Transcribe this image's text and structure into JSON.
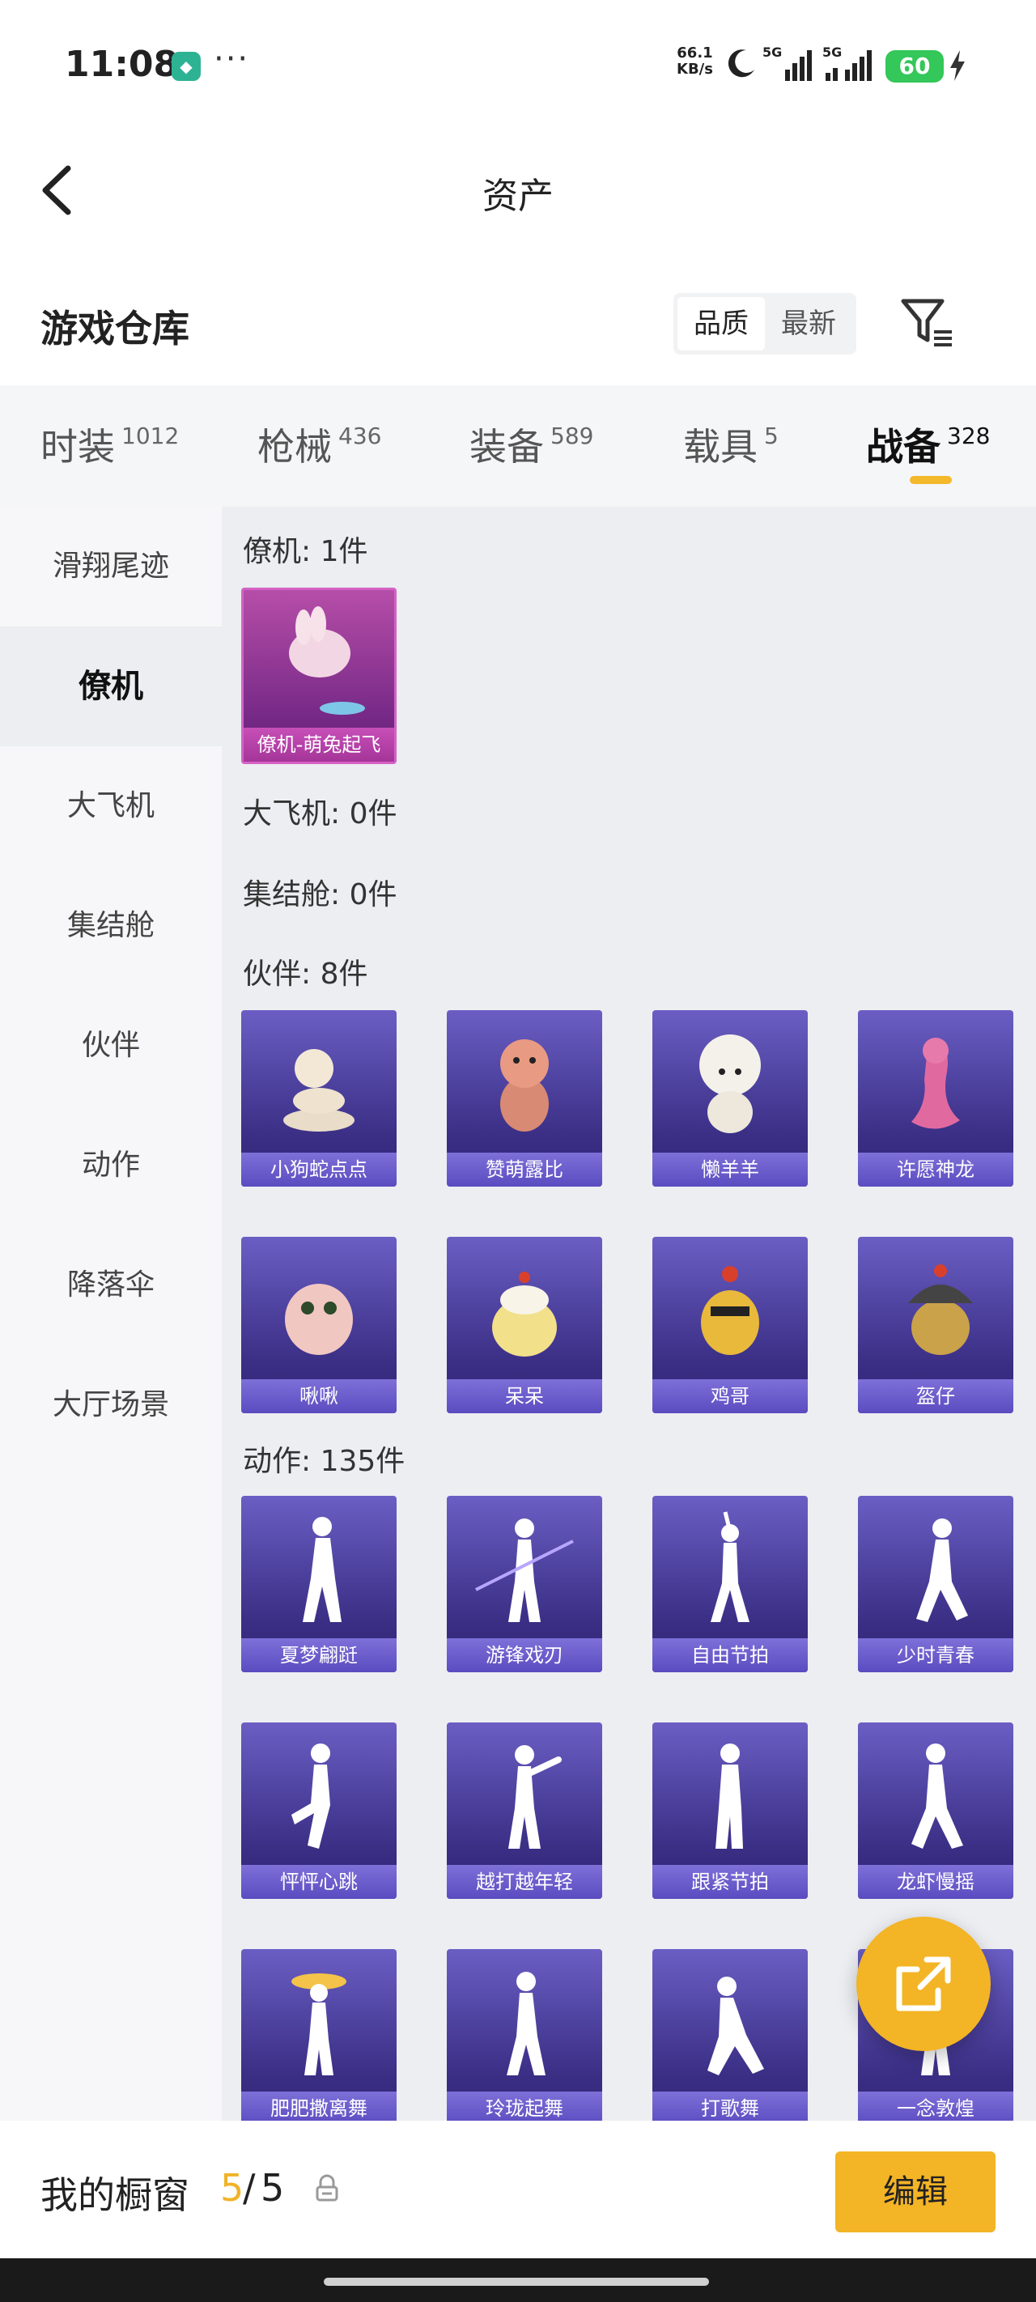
{
  "status_bar": {
    "time": "11:08",
    "chat_icon": "wechat-icon",
    "more": "···",
    "speed_value": "66.1",
    "speed_unit": "KB/s",
    "network_1": "5G",
    "network_2": "5G",
    "battery": "60"
  },
  "header": {
    "title": "资产",
    "back_icon": "back-arrow-icon"
  },
  "warehouse": {
    "title": "游戏仓库",
    "sort_options": [
      "品质",
      "最新"
    ],
    "active_sort": "品质",
    "filter_icon": "filter-icon"
  },
  "category_tabs": [
    {
      "label": "时装",
      "count": "1012"
    },
    {
      "label": "枪械",
      "count": "436"
    },
    {
      "label": "装备",
      "count": "589"
    },
    {
      "label": "载具",
      "count": "5"
    },
    {
      "label": "战备",
      "count": "328"
    }
  ],
  "active_tab": "战备",
  "sidebar": [
    {
      "label": "滑翔尾迹"
    },
    {
      "label": "僚机"
    },
    {
      "label": "大飞机"
    },
    {
      "label": "集结舱"
    },
    {
      "label": "伙伴"
    },
    {
      "label": "动作"
    },
    {
      "label": "降落伞"
    },
    {
      "label": "大厅场景"
    }
  ],
  "active_sidebar": "僚机",
  "groups": {
    "wingman": {
      "heading": "僚机: 1件",
      "items": [
        "僚机-萌兔起飞"
      ]
    },
    "big_plane": {
      "heading": "大飞机: 0件"
    },
    "assembly_pod": {
      "heading": "集结舱: 0件"
    },
    "partner": {
      "heading": "伙伴: 8件",
      "items": [
        "小狗蛇点点",
        "赞萌露比",
        "懒羊羊",
        "许愿神龙",
        "啾啾",
        "呆呆",
        "鸡哥",
        "盔仔"
      ]
    },
    "action": {
      "heading": "动作: 135件",
      "items": [
        "夏梦翩跹",
        "游锋戏刃",
        "自由节拍",
        "少时青春",
        "怦怦心跳",
        "越打越年轻",
        "跟紧节拍",
        "龙虾慢摇",
        "肥肥撒离舞",
        "玲珑起舞",
        "打歌舞",
        "一念敦煌"
      ]
    }
  },
  "fab_icon": "share-external-icon",
  "bottom_bar": {
    "label": "我的橱窗",
    "current": "5",
    "slash": "/",
    "max": "5",
    "lock_icon": "lock-icon",
    "edit_button": "编辑"
  },
  "colors": {
    "accent": "#f3b425",
    "card_purple": "#4a3ea6",
    "card_pink": "#a53599"
  }
}
